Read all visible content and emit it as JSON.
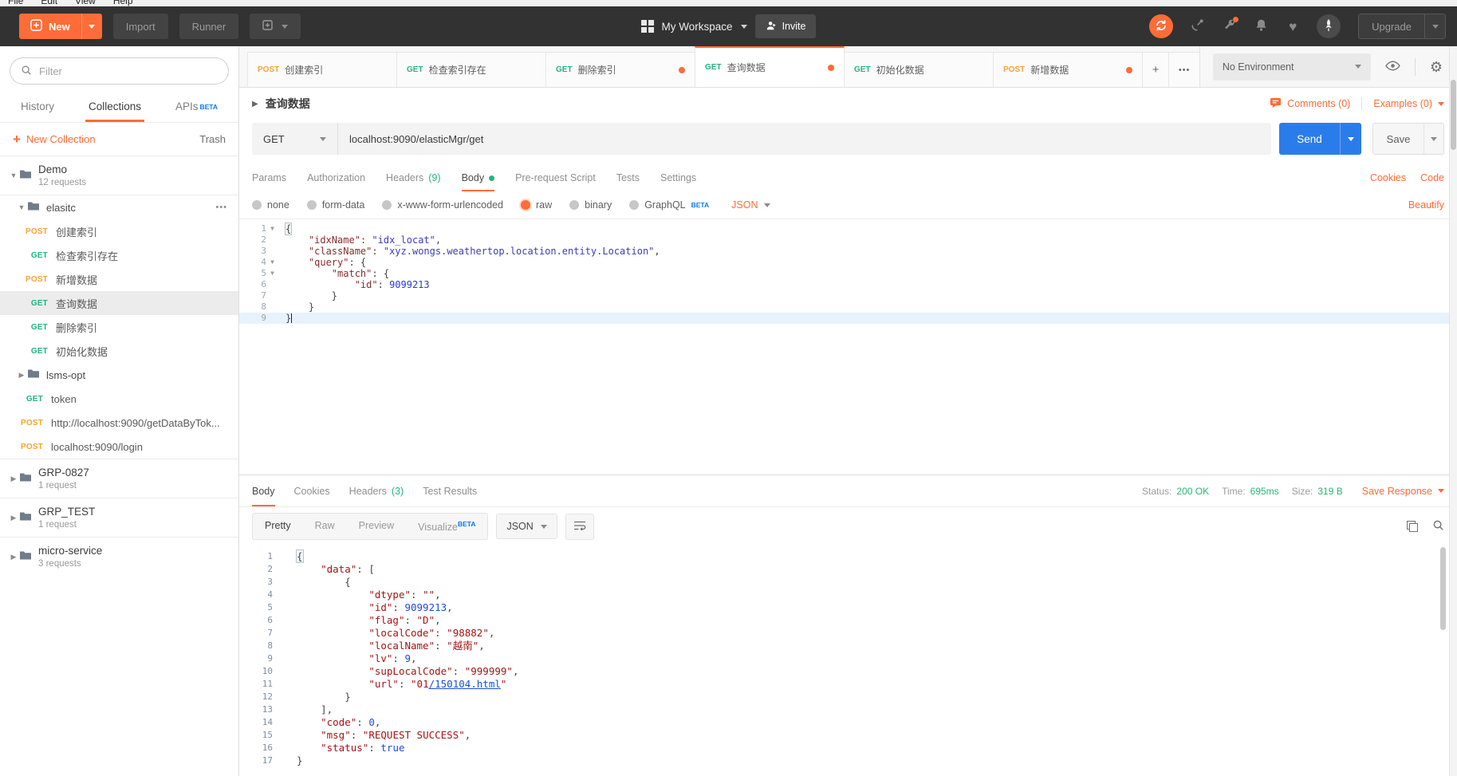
{
  "colors": {
    "accent_orange": "#ff6c37",
    "method_get": "#26b47e",
    "method_post": "#f7a336",
    "send_blue": "#2b7ceb",
    "status_green": "#2bb673",
    "beta_blue": "#097bed"
  },
  "icons": [
    "plus-icon",
    "search-icon",
    "folder-icon",
    "grid-icon",
    "invite-person-icon",
    "sync-icon",
    "satellite-icon",
    "wrench-icon",
    "bell-icon",
    "heart-icon",
    "rocket-avatar-icon",
    "eye-icon",
    "gear-icon",
    "comment-icon",
    "copy-icon",
    "wrap-text-icon",
    "chevron-down-icon",
    "chevron-right-icon"
  ],
  "menu_bar": {
    "items": [
      "File",
      "Edit",
      "View",
      "Help"
    ]
  },
  "header": {
    "new_label": "New",
    "import_label": "Import",
    "runner_label": "Runner",
    "workspace_label": "My Workspace",
    "invite_label": "Invite",
    "upgrade_label": "Upgrade"
  },
  "top_tabs": {
    "tabs": [
      {
        "method": "POST",
        "label": "创建索引",
        "dot": false,
        "active": false
      },
      {
        "method": "GET",
        "label": "检查索引存在",
        "dot": false,
        "active": false
      },
      {
        "method": "GET",
        "label": "删除索引",
        "dot": true,
        "active": false
      },
      {
        "method": "GET",
        "label": "查询数据",
        "dot": true,
        "active": true
      },
      {
        "method": "GET",
        "label": "初始化数据",
        "dot": false,
        "active": false
      },
      {
        "method": "POST",
        "label": "新增数据",
        "dot": true,
        "active": false
      }
    ],
    "add_label": "+",
    "more_label": "•••",
    "environment_selected": "No Environment"
  },
  "sidebar": {
    "filter_placeholder": "Filter",
    "tabs": [
      {
        "label": "History",
        "active": false,
        "beta": false
      },
      {
        "label": "Collections",
        "active": true,
        "beta": false
      },
      {
        "label": "APIs",
        "active": false,
        "beta": true
      }
    ],
    "beta_label": "BETA",
    "new_collection_label": "New Collection",
    "trash_label": "Trash",
    "menu_dots": "•••",
    "tree": [
      {
        "type": "collection",
        "name": "Demo",
        "meta": "12 requests",
        "expanded": true,
        "divider_bottom": true
      },
      {
        "type": "folder",
        "name": "elasitc",
        "expanded": true,
        "menu": true
      },
      {
        "type": "request",
        "method": "POST",
        "name": "创建索引",
        "indent": 2
      },
      {
        "type": "request",
        "method": "GET",
        "name": "检查索引存在",
        "indent": 2
      },
      {
        "type": "request",
        "method": "POST",
        "name": "新增数据",
        "indent": 2
      },
      {
        "type": "request",
        "method": "GET",
        "name": "查询数据",
        "indent": 2,
        "selected": true
      },
      {
        "type": "request",
        "method": "GET",
        "name": "删除索引",
        "indent": 2
      },
      {
        "type": "request",
        "method": "GET",
        "name": "初始化数据",
        "indent": 2
      },
      {
        "type": "folder",
        "name": "lsms-opt",
        "expanded": false
      },
      {
        "type": "request",
        "method": "GET",
        "name": "token",
        "indent": 1
      },
      {
        "type": "request",
        "method": "POST",
        "name": "http://localhost:9090/getDataByTok...",
        "indent": 1
      },
      {
        "type": "request",
        "method": "POST",
        "name": "localhost:9090/login",
        "indent": 1
      },
      {
        "type": "collection",
        "name": "GRP-0827",
        "meta": "1 request",
        "expanded": false,
        "divider_top": true
      },
      {
        "type": "collection",
        "name": "GRP_TEST",
        "meta": "1 request",
        "expanded": false,
        "divider_top": true
      },
      {
        "type": "collection",
        "name": "micro-service",
        "meta": "3 requests",
        "expanded": false,
        "divider_top": true
      }
    ]
  },
  "request": {
    "title": "查询数据",
    "comments_label": "Comments (0)",
    "examples_label": "Examples (0)",
    "method": "GET",
    "url": "localhost:9090/elasticMgr/get",
    "send_label": "Send",
    "save_label": "Save",
    "tabs": [
      {
        "label": "Params"
      },
      {
        "label": "Authorization"
      },
      {
        "label": "Headers",
        "count": "(9)"
      },
      {
        "label": "Body",
        "dot": true,
        "active": true
      },
      {
        "label": "Pre-request Script"
      },
      {
        "label": "Tests"
      },
      {
        "label": "Settings"
      }
    ],
    "cookies_label": "Cookies",
    "code_label": "Code",
    "body_types": [
      {
        "label": "none"
      },
      {
        "label": "form-data"
      },
      {
        "label": "x-www-form-urlencoded"
      },
      {
        "label": "raw",
        "selected": true
      },
      {
        "label": "binary"
      },
      {
        "label": "GraphQL",
        "beta": true
      }
    ],
    "language": "JSON",
    "beautify_label": "Beautify",
    "editor_lines": [
      {
        "n": "1",
        "fold": true,
        "tokens": [
          {
            "t": "{",
            "c": "pb"
          }
        ]
      },
      {
        "n": "2",
        "tokens": [
          {
            "t": "    ",
            "c": "p"
          },
          {
            "t": "\"idxName\"",
            "c": "k"
          },
          {
            "t": ": ",
            "c": "p"
          },
          {
            "t": "\"idx_locat\"",
            "c": "s"
          },
          {
            "t": ",",
            "c": "p"
          }
        ]
      },
      {
        "n": "3",
        "tokens": [
          {
            "t": "    ",
            "c": "p"
          },
          {
            "t": "\"className\"",
            "c": "k"
          },
          {
            "t": ": ",
            "c": "p"
          },
          {
            "t": "\"xyz.wongs.weathertop.location.entity.Location\"",
            "c": "s"
          },
          {
            "t": ",",
            "c": "p"
          }
        ]
      },
      {
        "n": "4",
        "fold": true,
        "tokens": [
          {
            "t": "    ",
            "c": "p"
          },
          {
            "t": "\"query\"",
            "c": "k"
          },
          {
            "t": ": {",
            "c": "p"
          }
        ]
      },
      {
        "n": "5",
        "fold": true,
        "tokens": [
          {
            "t": "        ",
            "c": "p"
          },
          {
            "t": "\"match\"",
            "c": "k"
          },
          {
            "t": ": {",
            "c": "p"
          }
        ]
      },
      {
        "n": "6",
        "tokens": [
          {
            "t": "            ",
            "c": "p"
          },
          {
            "t": "\"id\"",
            "c": "k"
          },
          {
            "t": ": ",
            "c": "p"
          },
          {
            "t": "9099213",
            "c": "n"
          }
        ]
      },
      {
        "n": "7",
        "tokens": [
          {
            "t": "        }",
            "c": "p"
          }
        ]
      },
      {
        "n": "8",
        "tokens": [
          {
            "t": "    }",
            "c": "p"
          }
        ]
      },
      {
        "n": "9",
        "active": true,
        "cursor": true,
        "tokens": [
          {
            "t": "}",
            "c": "p"
          }
        ]
      }
    ]
  },
  "response": {
    "tabs": [
      {
        "label": "Body",
        "active": true
      },
      {
        "label": "Cookies"
      },
      {
        "label": "Headers",
        "count": "(3)"
      },
      {
        "label": "Test Results"
      }
    ],
    "status_label": "Status:",
    "status_value": "200 OK",
    "time_label": "Time:",
    "time_value": "695ms",
    "size_label": "Size:",
    "size_value": "319 B",
    "save_response_label": "Save Response",
    "views": [
      {
        "label": "Pretty",
        "active": true
      },
      {
        "label": "Raw"
      },
      {
        "label": "Preview"
      },
      {
        "label": "Visualize",
        "beta": true
      }
    ],
    "beta_label": "BETA",
    "language": "JSON",
    "lines": [
      {
        "n": "1",
        "tokens": [
          {
            "t": "{",
            "c": "pb"
          }
        ]
      },
      {
        "n": "2",
        "tokens": [
          {
            "t": "    ",
            "c": "p"
          },
          {
            "t": "\"data\"",
            "c": "rk"
          },
          {
            "t": ": [",
            "c": "p"
          }
        ]
      },
      {
        "n": "3",
        "tokens": [
          {
            "t": "        {",
            "c": "p"
          }
        ]
      },
      {
        "n": "4",
        "tokens": [
          {
            "t": "            ",
            "c": "p"
          },
          {
            "t": "\"dtype\"",
            "c": "rk"
          },
          {
            "t": ": ",
            "c": "p"
          },
          {
            "t": "\"\"",
            "c": "rs"
          },
          {
            "t": ",",
            "c": "p"
          }
        ]
      },
      {
        "n": "5",
        "tokens": [
          {
            "t": "            ",
            "c": "p"
          },
          {
            "t": "\"id\"",
            "c": "rk"
          },
          {
            "t": ": ",
            "c": "p"
          },
          {
            "t": "9099213",
            "c": "rn"
          },
          {
            "t": ",",
            "c": "p"
          }
        ]
      },
      {
        "n": "6",
        "tokens": [
          {
            "t": "            ",
            "c": "p"
          },
          {
            "t": "\"flag\"",
            "c": "rk"
          },
          {
            "t": ": ",
            "c": "p"
          },
          {
            "t": "\"D\"",
            "c": "rs"
          },
          {
            "t": ",",
            "c": "p"
          }
        ]
      },
      {
        "n": "7",
        "tokens": [
          {
            "t": "            ",
            "c": "p"
          },
          {
            "t": "\"localCode\"",
            "c": "rk"
          },
          {
            "t": ": ",
            "c": "p"
          },
          {
            "t": "\"98882\"",
            "c": "rs"
          },
          {
            "t": ",",
            "c": "p"
          }
        ]
      },
      {
        "n": "8",
        "tokens": [
          {
            "t": "            ",
            "c": "p"
          },
          {
            "t": "\"localName\"",
            "c": "rk"
          },
          {
            "t": ": ",
            "c": "p"
          },
          {
            "t": "\"越南\"",
            "c": "rs"
          },
          {
            "t": ",",
            "c": "p"
          }
        ]
      },
      {
        "n": "9",
        "tokens": [
          {
            "t": "            ",
            "c": "p"
          },
          {
            "t": "\"lv\"",
            "c": "rk"
          },
          {
            "t": ": ",
            "c": "p"
          },
          {
            "t": "9",
            "c": "rn"
          },
          {
            "t": ",",
            "c": "p"
          }
        ]
      },
      {
        "n": "10",
        "tokens": [
          {
            "t": "            ",
            "c": "p"
          },
          {
            "t": "\"supLocalCode\"",
            "c": "rk"
          },
          {
            "t": ": ",
            "c": "p"
          },
          {
            "t": "\"999999\"",
            "c": "rs"
          },
          {
            "t": ",",
            "c": "p"
          }
        ]
      },
      {
        "n": "11",
        "tokens": [
          {
            "t": "            ",
            "c": "p"
          },
          {
            "t": "\"url\"",
            "c": "rk"
          },
          {
            "t": ": ",
            "c": "p"
          },
          {
            "t": "\"01",
            "c": "rs"
          },
          {
            "t": "/150104.html",
            "c": "rl"
          },
          {
            "t": "\"",
            "c": "rs"
          }
        ]
      },
      {
        "n": "12",
        "tokens": [
          {
            "t": "        }",
            "c": "p"
          }
        ]
      },
      {
        "n": "13",
        "tokens": [
          {
            "t": "    ],",
            "c": "p"
          }
        ]
      },
      {
        "n": "14",
        "tokens": [
          {
            "t": "    ",
            "c": "p"
          },
          {
            "t": "\"code\"",
            "c": "rk"
          },
          {
            "t": ": ",
            "c": "p"
          },
          {
            "t": "0",
            "c": "rn"
          },
          {
            "t": ",",
            "c": "p"
          }
        ]
      },
      {
        "n": "15",
        "tokens": [
          {
            "t": "    ",
            "c": "p"
          },
          {
            "t": "\"msg\"",
            "c": "rk"
          },
          {
            "t": ": ",
            "c": "p"
          },
          {
            "t": "\"REQUEST SUCCESS\"",
            "c": "rs"
          },
          {
            "t": ",",
            "c": "p"
          }
        ]
      },
      {
        "n": "16",
        "tokens": [
          {
            "t": "    ",
            "c": "p"
          },
          {
            "t": "\"status\"",
            "c": "rk"
          },
          {
            "t": ": ",
            "c": "p"
          },
          {
            "t": "true",
            "c": "rb"
          }
        ]
      },
      {
        "n": "17",
        "tokens": [
          {
            "t": "}",
            "c": "p"
          }
        ]
      }
    ]
  }
}
